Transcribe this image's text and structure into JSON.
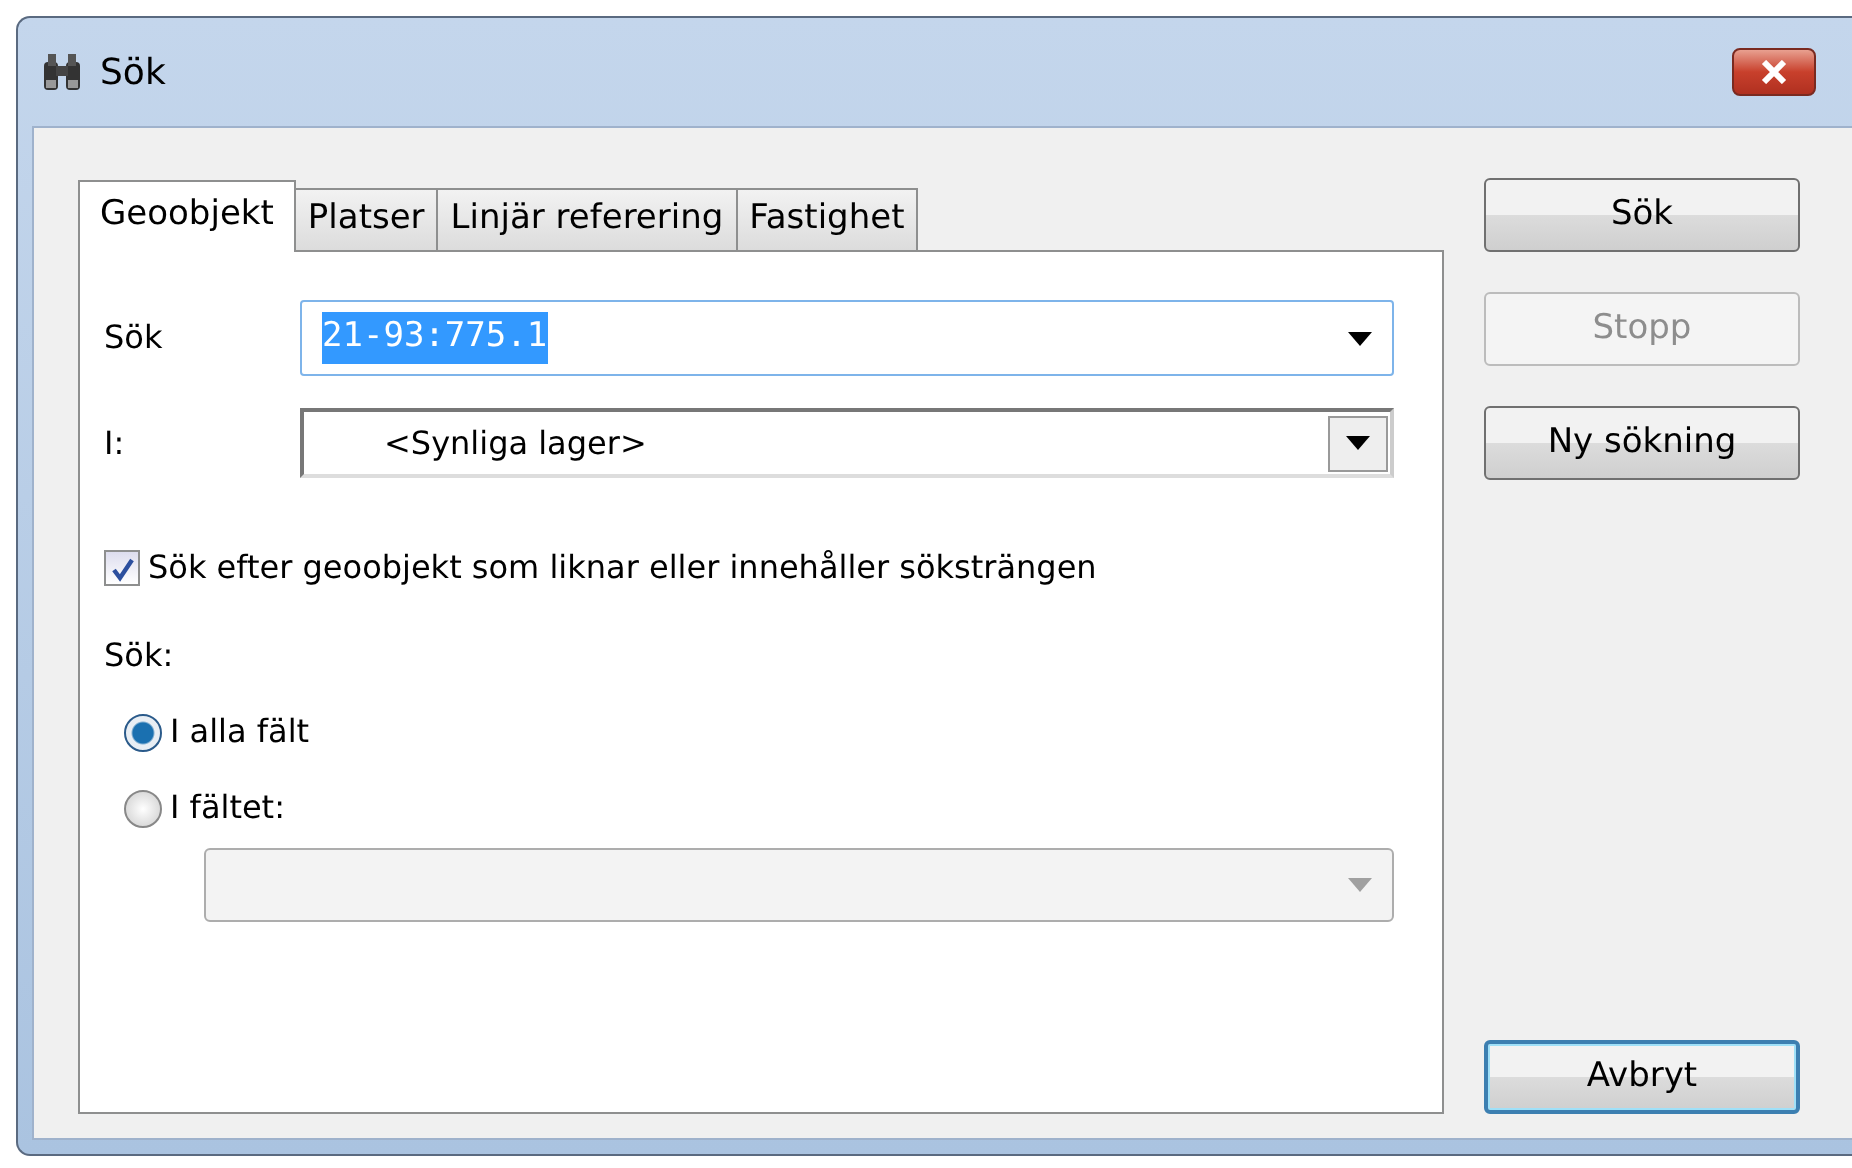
{
  "window": {
    "title": "Sök"
  },
  "tabs": [
    {
      "label": "Geoobjekt",
      "selected": true
    },
    {
      "label": "Platser",
      "selected": false
    },
    {
      "label": "Linjär referering",
      "selected": false
    },
    {
      "label": "Fastighet",
      "selected": false
    }
  ],
  "search_field": {
    "label": "Sök",
    "value": "21-93:775.1"
  },
  "layer_field": {
    "label": "I:",
    "value": "<Synliga lager>"
  },
  "similar_checkbox": {
    "label": "Sök efter geoobjekt som liknar eller innehåller söksträngen",
    "checked": true
  },
  "search_in": {
    "label": "Sök:",
    "options": [
      {
        "label": "I alla fält",
        "selected": true
      },
      {
        "label": "I fältet:",
        "selected": false
      }
    ],
    "field_dropdown": {
      "disabled": true
    }
  },
  "buttons": [
    {
      "label": "Sök",
      "disabled": false,
      "default": false
    },
    {
      "label": "Stopp",
      "disabled": true,
      "default": false
    },
    {
      "label": "Ny sökning",
      "disabled": false,
      "default": false
    },
    {
      "label": "Avbryt",
      "disabled": false,
      "default": true
    }
  ]
}
